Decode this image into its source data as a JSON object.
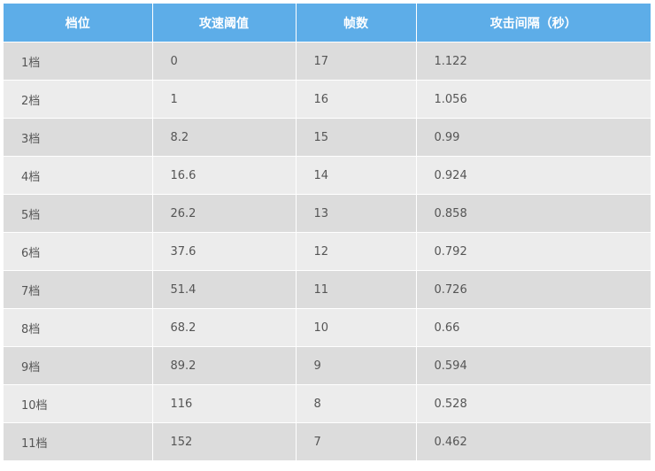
{
  "table": {
    "headers": [
      "档位",
      "攻速阈值",
      "帧数",
      "攻击间隔（秒）"
    ],
    "rows": [
      [
        "1档",
        "0",
        "17",
        "1.122"
      ],
      [
        "2档",
        "1",
        "16",
        "1.056"
      ],
      [
        "3档",
        "8.2",
        "15",
        "0.99"
      ],
      [
        "4档",
        "16.6",
        "14",
        "0.924"
      ],
      [
        "5档",
        "26.2",
        "13",
        "0.858"
      ],
      [
        "6档",
        "37.6",
        "12",
        "0.792"
      ],
      [
        "7档",
        "51.4",
        "11",
        "0.726"
      ],
      [
        "8档",
        "68.2",
        "10",
        "0.66"
      ],
      [
        "9档",
        "89.2",
        "9",
        "0.594"
      ],
      [
        "10档",
        "116",
        "8",
        "0.528"
      ],
      [
        "11档",
        "152",
        "7",
        "0.462"
      ]
    ]
  },
  "colors": {
    "header_bg": "#5dade8",
    "row_odd": "#dcdcdc",
    "row_even": "#ececec",
    "text": "#555555"
  }
}
